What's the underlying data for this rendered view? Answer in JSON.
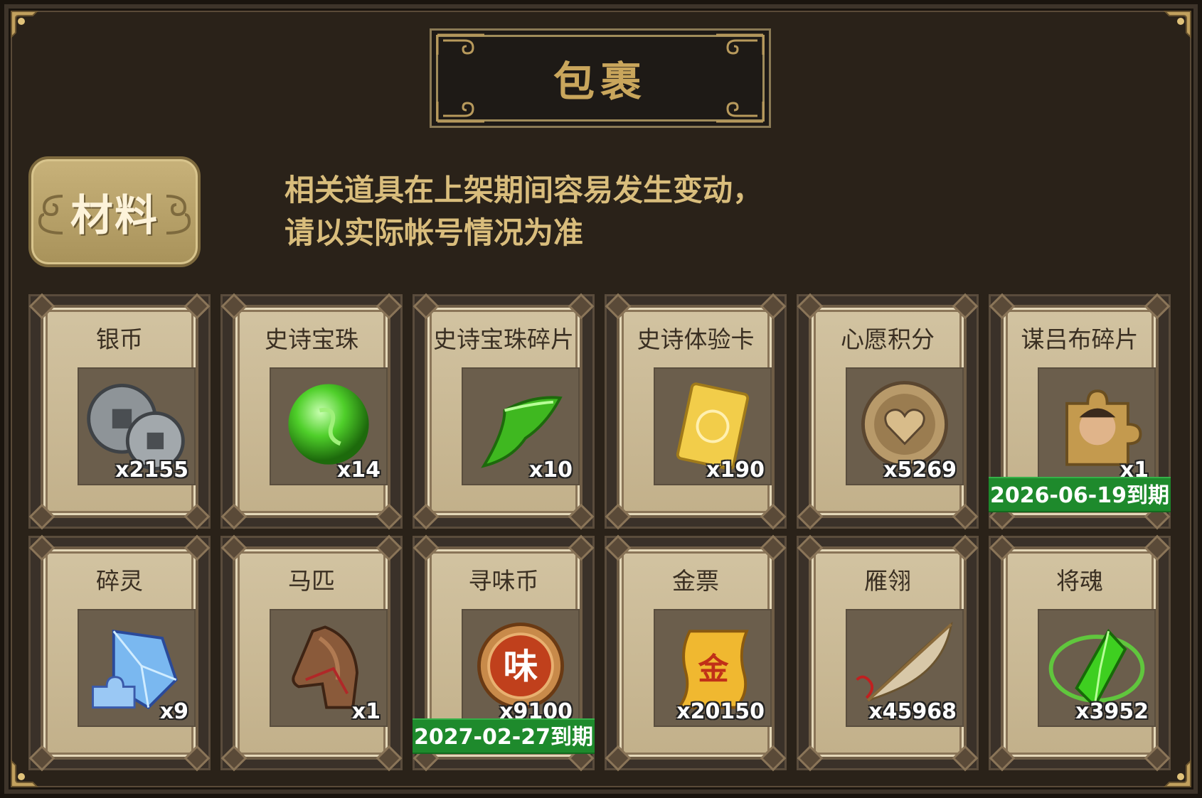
{
  "header": {
    "title": "包裹"
  },
  "category_tab": {
    "label": "材料"
  },
  "notice": {
    "line1": "相关道具在上架期间容易发生变动，",
    "line2": "请以实际帐号情况为准"
  },
  "items": [
    {
      "name": "银币",
      "qty": "x2155",
      "icon": "silver-coin-icon"
    },
    {
      "name": "史诗宝珠",
      "qty": "x14",
      "icon": "green-orb-icon"
    },
    {
      "name": "史诗宝珠碎片",
      "qty": "x10",
      "icon": "green-shard-icon"
    },
    {
      "name": "史诗体验卡",
      "qty": "x190",
      "icon": "gold-card-icon"
    },
    {
      "name": "心愿积分",
      "qty": "x5269",
      "icon": "heart-coin-icon"
    },
    {
      "name": "谋吕布碎片",
      "qty": "x1",
      "icon": "puzzle-portrait-icon",
      "expiry": "2026-06-19到期"
    },
    {
      "name": "碎灵",
      "qty": "x9",
      "icon": "blue-crystal-icon"
    },
    {
      "name": "马匹",
      "qty": "x1",
      "icon": "horse-head-icon"
    },
    {
      "name": "寻味币",
      "qty": "x9100",
      "icon": "flavor-coin-icon",
      "coin_char": "味",
      "expiry": "2027-02-27到期"
    },
    {
      "name": "金票",
      "qty": "x20150",
      "icon": "gold-scroll-icon",
      "scroll_char": "金"
    },
    {
      "name": "雁翎",
      "qty": "x45968",
      "icon": "feather-icon"
    },
    {
      "name": "将魂",
      "qty": "x3952",
      "icon": "green-soul-crystal-icon"
    }
  ]
}
